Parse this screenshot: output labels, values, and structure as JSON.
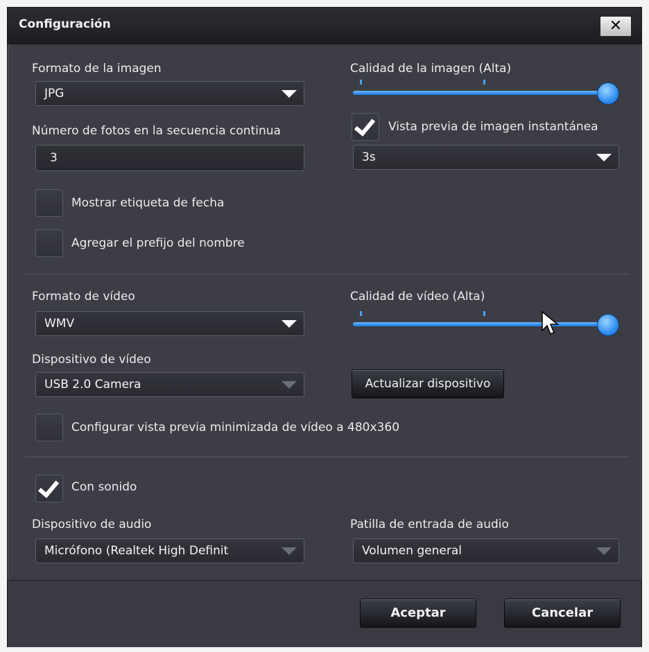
{
  "window": {
    "title": "Configuración"
  },
  "image": {
    "format_label": "Formato de la imagen",
    "format_value": "JPG",
    "quality_label": "Calidad de la imagen  (Alta)",
    "quality_level": 1.0,
    "burst_label": "Número de fotos en la secuencia continua",
    "burst_value": "3",
    "preview_label": "Vista previa de imagen instantánea",
    "preview_checked": true,
    "preview_duration": "3s",
    "date_stamp_label": "Mostrar etiqueta de fecha",
    "date_stamp_checked": false,
    "prefix_label": "Agregar el prefijo del nombre",
    "prefix_checked": false
  },
  "video": {
    "format_label": "Formato de vídeo",
    "format_value": "WMV",
    "quality_label": "Calidad de vídeo  (Alta)",
    "quality_level": 1.0,
    "device_label": "Dispositivo de vídeo",
    "device_value": "USB 2.0 Camera",
    "refresh_button": "Actualizar dispositivo",
    "mini_preview_label": "Configurar vista previa minimizada de vídeo a 480x360",
    "mini_preview_checked": false
  },
  "audio": {
    "with_sound_label": "Con sonido",
    "with_sound_checked": true,
    "device_label": "Dispositivo de audio",
    "device_value": "Micrófono (Realtek High Definit",
    "input_label": "Patilla de entrada de audio",
    "input_value": "Volumen general"
  },
  "footer": {
    "accept": "Aceptar",
    "cancel": "Cancelar"
  },
  "colors": {
    "dialog_bg": "#3c3d45",
    "accent": "#2f8ff0"
  }
}
